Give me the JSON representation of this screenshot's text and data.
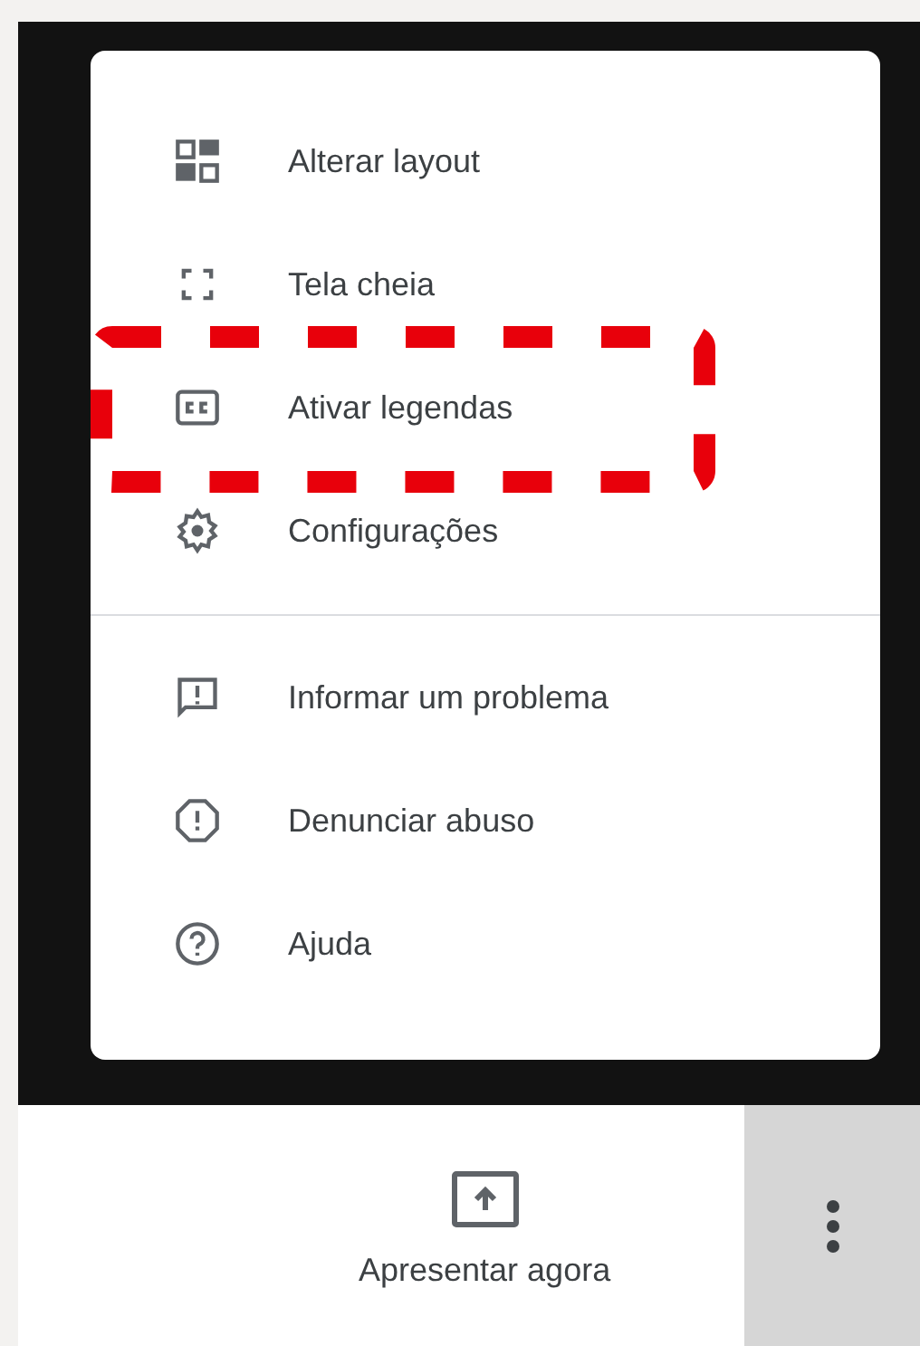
{
  "menu": {
    "sections": [
      {
        "items": [
          {
            "label": "Alterar layout",
            "annotated": false
          },
          {
            "label": "Tela cheia",
            "annotated": false
          },
          {
            "label": "Ativar legendas",
            "annotated": true
          },
          {
            "label": "Configurações",
            "annotated": false
          }
        ]
      },
      {
        "items": [
          {
            "label": "Informar um problema",
            "annotated": false
          },
          {
            "label": "Denunciar abuso",
            "annotated": false
          },
          {
            "label": "Ajuda",
            "annotated": false
          }
        ]
      }
    ]
  },
  "toolbar": {
    "present_button": {
      "label": "Apresentar agora"
    }
  }
}
